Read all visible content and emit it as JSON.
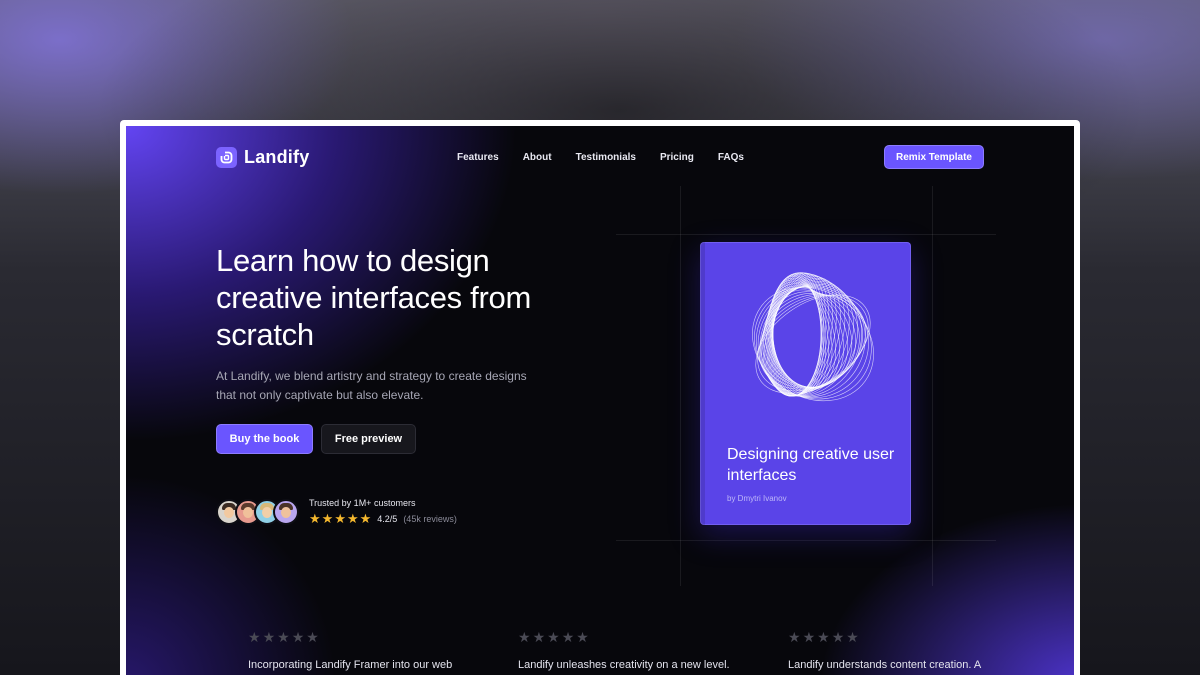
{
  "brand": {
    "name": "Landify"
  },
  "nav": {
    "links": [
      "Features",
      "About",
      "Testimonials",
      "Pricing",
      "FAQs"
    ],
    "cta_label": "Remix Template"
  },
  "hero": {
    "title": "Learn how to design creative interfaces from scratch",
    "subtitle": "At Landify, we blend artistry and strategy to create designs that not only captivate but also elevate.",
    "primary_button": "Buy the book",
    "secondary_button": "Free preview"
  },
  "social_proof": {
    "trusted_text": "Trusted by 1M+ customers",
    "rating": "4.2/5",
    "reviews": "(45k reviews)",
    "stars_filled": 5
  },
  "book": {
    "title": "Designing creative user interfaces",
    "author": "by Dmytri Ivanov"
  },
  "testimonials": [
    {
      "text": "Incorporating Landify Framer into our web",
      "stars": 5
    },
    {
      "text": "Landify unleashes creativity on a new level.",
      "stars": 5
    },
    {
      "text": "Landify understands content creation. A",
      "stars": 5
    }
  ],
  "colors": {
    "accent": "#6a55ff",
    "book_cover": "#5a44e8",
    "star_gold": "#f5b82e",
    "star_muted": "#4a4a55"
  },
  "icons": {
    "brand_logo": "landify-logo-icon",
    "star": "star-icon"
  }
}
